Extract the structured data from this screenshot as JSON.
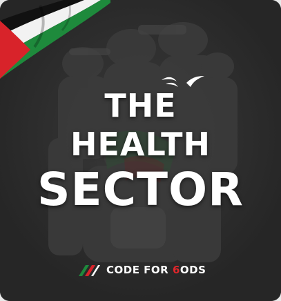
{
  "poster": {
    "title_line1": "THE",
    "title_line2": "HEALTH",
    "title_line3": "SECTOR"
  },
  "brand": {
    "name_part1": "CODE FOR ",
    "name_accent": "6",
    "name_part2": "ODS"
  },
  "colors": {
    "background": "#262626",
    "text": "#ffffff",
    "flag_red": "#d8232a",
    "flag_green": "#1e8a3c",
    "flag_black": "#111111",
    "brand_accent": "#e0262b"
  },
  "icons": {
    "flag": "palestine-flag-icon",
    "birds": "birds-icon",
    "logo": "code-for-gods-logo-icon"
  }
}
